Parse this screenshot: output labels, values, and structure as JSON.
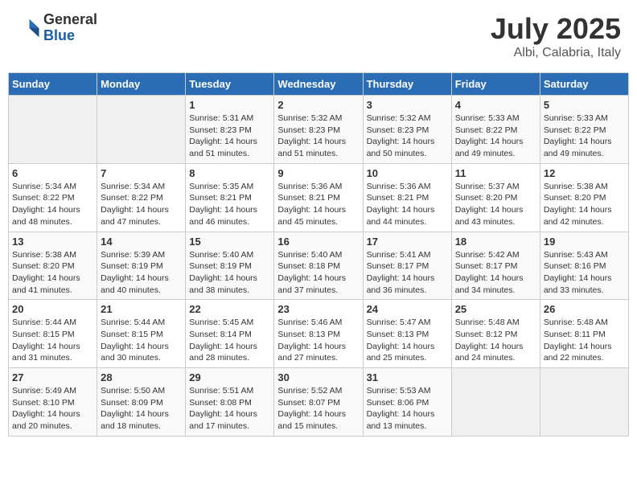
{
  "header": {
    "logo_general": "General",
    "logo_blue": "Blue",
    "month": "July 2025",
    "location": "Albi, Calabria, Italy"
  },
  "days_of_week": [
    "Sunday",
    "Monday",
    "Tuesday",
    "Wednesday",
    "Thursday",
    "Friday",
    "Saturday"
  ],
  "weeks": [
    [
      {
        "day": "",
        "info": ""
      },
      {
        "day": "",
        "info": ""
      },
      {
        "day": "1",
        "sunrise": "5:31 AM",
        "sunset": "8:23 PM",
        "daylight": "14 hours and 51 minutes."
      },
      {
        "day": "2",
        "sunrise": "5:32 AM",
        "sunset": "8:23 PM",
        "daylight": "14 hours and 51 minutes."
      },
      {
        "day": "3",
        "sunrise": "5:32 AM",
        "sunset": "8:23 PM",
        "daylight": "14 hours and 50 minutes."
      },
      {
        "day": "4",
        "sunrise": "5:33 AM",
        "sunset": "8:22 PM",
        "daylight": "14 hours and 49 minutes."
      },
      {
        "day": "5",
        "sunrise": "5:33 AM",
        "sunset": "8:22 PM",
        "daylight": "14 hours and 49 minutes."
      }
    ],
    [
      {
        "day": "6",
        "sunrise": "5:34 AM",
        "sunset": "8:22 PM",
        "daylight": "14 hours and 48 minutes."
      },
      {
        "day": "7",
        "sunrise": "5:34 AM",
        "sunset": "8:22 PM",
        "daylight": "14 hours and 47 minutes."
      },
      {
        "day": "8",
        "sunrise": "5:35 AM",
        "sunset": "8:21 PM",
        "daylight": "14 hours and 46 minutes."
      },
      {
        "day": "9",
        "sunrise": "5:36 AM",
        "sunset": "8:21 PM",
        "daylight": "14 hours and 45 minutes."
      },
      {
        "day": "10",
        "sunrise": "5:36 AM",
        "sunset": "8:21 PM",
        "daylight": "14 hours and 44 minutes."
      },
      {
        "day": "11",
        "sunrise": "5:37 AM",
        "sunset": "8:20 PM",
        "daylight": "14 hours and 43 minutes."
      },
      {
        "day": "12",
        "sunrise": "5:38 AM",
        "sunset": "8:20 PM",
        "daylight": "14 hours and 42 minutes."
      }
    ],
    [
      {
        "day": "13",
        "sunrise": "5:38 AM",
        "sunset": "8:20 PM",
        "daylight": "14 hours and 41 minutes."
      },
      {
        "day": "14",
        "sunrise": "5:39 AM",
        "sunset": "8:19 PM",
        "daylight": "14 hours and 40 minutes."
      },
      {
        "day": "15",
        "sunrise": "5:40 AM",
        "sunset": "8:19 PM",
        "daylight": "14 hours and 38 minutes."
      },
      {
        "day": "16",
        "sunrise": "5:40 AM",
        "sunset": "8:18 PM",
        "daylight": "14 hours and 37 minutes."
      },
      {
        "day": "17",
        "sunrise": "5:41 AM",
        "sunset": "8:17 PM",
        "daylight": "14 hours and 36 minutes."
      },
      {
        "day": "18",
        "sunrise": "5:42 AM",
        "sunset": "8:17 PM",
        "daylight": "14 hours and 34 minutes."
      },
      {
        "day": "19",
        "sunrise": "5:43 AM",
        "sunset": "8:16 PM",
        "daylight": "14 hours and 33 minutes."
      }
    ],
    [
      {
        "day": "20",
        "sunrise": "5:44 AM",
        "sunset": "8:15 PM",
        "daylight": "14 hours and 31 minutes."
      },
      {
        "day": "21",
        "sunrise": "5:44 AM",
        "sunset": "8:15 PM",
        "daylight": "14 hours and 30 minutes."
      },
      {
        "day": "22",
        "sunrise": "5:45 AM",
        "sunset": "8:14 PM",
        "daylight": "14 hours and 28 minutes."
      },
      {
        "day": "23",
        "sunrise": "5:46 AM",
        "sunset": "8:13 PM",
        "daylight": "14 hours and 27 minutes."
      },
      {
        "day": "24",
        "sunrise": "5:47 AM",
        "sunset": "8:13 PM",
        "daylight": "14 hours and 25 minutes."
      },
      {
        "day": "25",
        "sunrise": "5:48 AM",
        "sunset": "8:12 PM",
        "daylight": "14 hours and 24 minutes."
      },
      {
        "day": "26",
        "sunrise": "5:48 AM",
        "sunset": "8:11 PM",
        "daylight": "14 hours and 22 minutes."
      }
    ],
    [
      {
        "day": "27",
        "sunrise": "5:49 AM",
        "sunset": "8:10 PM",
        "daylight": "14 hours and 20 minutes."
      },
      {
        "day": "28",
        "sunrise": "5:50 AM",
        "sunset": "8:09 PM",
        "daylight": "14 hours and 18 minutes."
      },
      {
        "day": "29",
        "sunrise": "5:51 AM",
        "sunset": "8:08 PM",
        "daylight": "14 hours and 17 minutes."
      },
      {
        "day": "30",
        "sunrise": "5:52 AM",
        "sunset": "8:07 PM",
        "daylight": "14 hours and 15 minutes."
      },
      {
        "day": "31",
        "sunrise": "5:53 AM",
        "sunset": "8:06 PM",
        "daylight": "14 hours and 13 minutes."
      },
      {
        "day": "",
        "info": ""
      },
      {
        "day": "",
        "info": ""
      }
    ]
  ]
}
